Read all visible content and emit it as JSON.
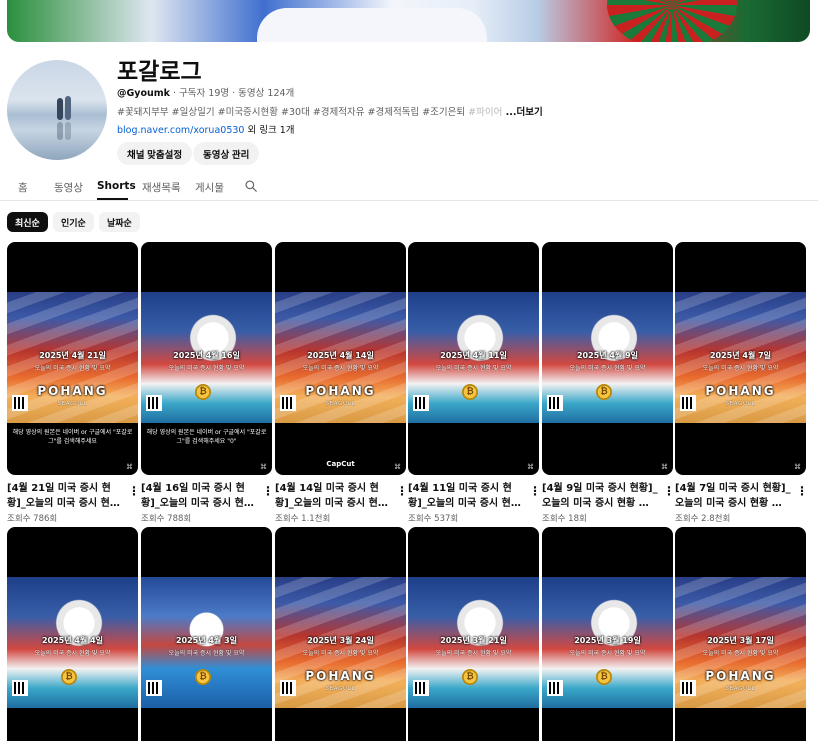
{
  "channel": {
    "name": "포갈로그",
    "handle": "@Gyoumk",
    "subscribers": " · 구독자 19명 · 동영상 124개",
    "description": "#꽃돼지부부 #일상일기 #미국증시현황 #30대 #경제적자유 #경제적독립 #조기은퇴 ",
    "description_fade": "#파이어",
    "more": " ...더보기",
    "link_url": "blog.naver.com/xorua0530",
    "link_extra": " 외 링크 1개",
    "buttons": {
      "customize": "채널 맞춤설정",
      "manage": "동영상 관리"
    }
  },
  "tabs": [
    {
      "label": "홈"
    },
    {
      "label": "동영상"
    },
    {
      "label": "Shorts"
    },
    {
      "label": "재생목록"
    },
    {
      "label": "게시물"
    }
  ],
  "chips": [
    {
      "label": "최신순"
    },
    {
      "label": "인기순"
    },
    {
      "label": "날짜순"
    }
  ],
  "videos": [
    {
      "title": "[4월 21일 미국 증시 현황]_오늘의 미국 증시 현…",
      "views": "조회수 786회",
      "date_text": "2025년 4월 21일",
      "caption": "해당 영상의 원본은 네이버 or 구글에서 \"포갈로그\"를 검색해주세요",
      "art": "flag"
    },
    {
      "title": "[4월 16일 미국 증시 현황]_오늘의 미국 증시 현…",
      "views": "조회수 788회",
      "date_text": "2025년 4월 16일",
      "caption": "해당 영상의 원본은 네이버 or 구글에서 \"포갈로그\"를 검색해주세요 \"0\"",
      "art": "eagle"
    },
    {
      "title": "[4월 14일 미국 증시 현황]_오늘의 미국 증시 현…",
      "views": "조회수 1.1천회",
      "date_text": "2025년 4월 14일",
      "caption": "",
      "art": "flag",
      "brand": "CapCut"
    },
    {
      "title": "[4월 11일 미국 증시 현황]_오늘의 미국 증시 현…",
      "views": "조회수 537회",
      "date_text": "2025년 4월 11일",
      "caption": "",
      "art": "eagle"
    },
    {
      "title": "[4월 9일 미국 증시 현황]_오늘의 미국 증시 현황 …",
      "views": "조회수 18회",
      "date_text": "2025년 4월 9일",
      "caption": "",
      "art": "eagle"
    },
    {
      "title": "[4월 7일 미국 증시 현황]_오늘의 미국 증시 현황 …",
      "views": "조회수 2.8천회",
      "date_text": "2025년 4월 7일",
      "caption": "",
      "art": "flag"
    },
    {
      "title": "",
      "views": "",
      "date_text": "2025년 4월 4일",
      "caption": "",
      "art": "eagle"
    },
    {
      "title": "",
      "views": "",
      "date_text": "2025년 4월 3일",
      "caption": "",
      "art": "duck"
    },
    {
      "title": "",
      "views": "",
      "date_text": "2025년 3월 24일",
      "caption": "",
      "art": "flag"
    },
    {
      "title": "",
      "views": "",
      "date_text": "2025년 3월 21일",
      "caption": "",
      "art": "eagle"
    },
    {
      "title": "",
      "views": "",
      "date_text": "2025년 3월 19일",
      "caption": "",
      "art": "eagle"
    },
    {
      "title": "",
      "views": "",
      "date_text": "2025년 3월 17일",
      "caption": "",
      "art": "flag"
    }
  ],
  "thumb_subtitle": "오늘의 미국 증시 현황 및 요약",
  "thumb_brand": "POHANG",
  "thumb_brand_sub": "SEAGULL",
  "menu_glyph": "⋮",
  "shorts_glyph": "⌘",
  "colors": {
    "link": "#065fd4",
    "selected_chip": "#0f0f0f",
    "muted": "#606060"
  }
}
